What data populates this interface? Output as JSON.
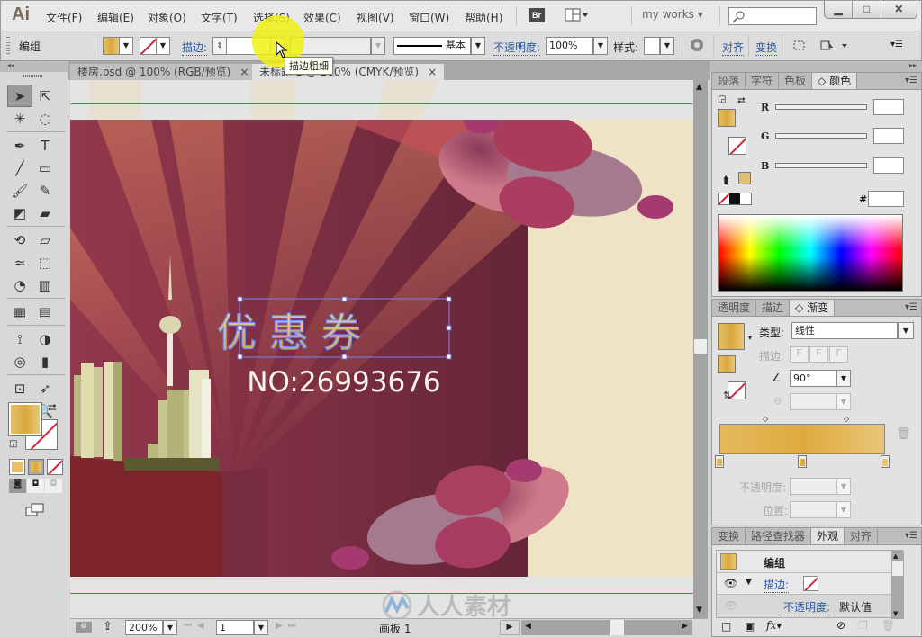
{
  "app": {
    "logo": "Ai"
  },
  "menubar": {
    "items": [
      "文件(F)",
      "编辑(E)",
      "对象(O)",
      "文字(T)",
      "选择(S)",
      "效果(C)",
      "视图(V)",
      "窗口(W)",
      "帮助(H)"
    ],
    "bridge_label": "Br",
    "workspace": "my works",
    "workspace_arrow": "▾",
    "search_placeholder": "",
    "window_buttons": {
      "minimize": "▁",
      "maximize": "□",
      "close": "✕"
    }
  },
  "controlbar": {
    "selection_label": "编组",
    "fill_color": "#e0b550",
    "stroke_label": "描边",
    "stroke_weight": "",
    "profile_label": "基本",
    "opacity_label": "不透明度",
    "opacity_value": "100%",
    "style_label": "样式",
    "align_label": "对齐",
    "transform_label": "变换"
  },
  "tooltip": {
    "text": "描边粗细"
  },
  "document_tabs": [
    {
      "label": "楼房.psd @ 100% (RGB/预览)",
      "close": "×"
    },
    {
      "label": "未标题-1 @ 200% (CMYK/预览)",
      "close": "×"
    }
  ],
  "artwork": {
    "title": "优惠券",
    "number": "NO:26993676",
    "background_color": "#8a2f45",
    "cream_color": "#efe3c6"
  },
  "tools": {
    "rows": [
      [
        "selection-tool",
        "direct-selection-tool"
      ],
      [
        "magic-wand-tool",
        "lasso-tool"
      ],
      [
        "pen-tool",
        "type-tool"
      ],
      [
        "line-tool",
        "rectangle-tool"
      ],
      [
        "paintbrush-tool",
        "pencil-tool"
      ],
      [
        "blob-brush-tool",
        "eraser-tool"
      ],
      [
        "rotate-tool",
        "free-transform-tool"
      ],
      [
        "width-tool",
        "shape-builder-tool"
      ],
      [
        "perspective-grid-tool",
        "graph-tool"
      ],
      [
        "mesh-tool",
        "gradient-tool"
      ],
      [
        "eyedropper-tool",
        "blend-tool"
      ],
      [
        "symbol-sprayer-tool",
        "column-graph-tool"
      ],
      [
        "artboard-tool",
        "slice-tool"
      ],
      [
        "hand-tool",
        "zoom-tool"
      ]
    ],
    "glyphs": [
      [
        "➤",
        "⇱"
      ],
      [
        "✳",
        "◌"
      ],
      [
        "✒",
        "T"
      ],
      [
        "╱",
        "▭"
      ],
      [
        "🖌",
        "✎"
      ],
      [
        "◩",
        "▰"
      ],
      [
        "⟲",
        "▱"
      ],
      [
        "≈",
        "⬚"
      ],
      [
        "◔",
        "▥"
      ],
      [
        "▦",
        "▤"
      ],
      [
        "⟟",
        "◑"
      ],
      [
        "◎",
        "▮"
      ],
      [
        "⊡",
        "➶"
      ],
      [
        "✋",
        "🔍"
      ]
    ]
  },
  "statusbar": {
    "zoom": "200%",
    "artboard_num": "1",
    "artboard_label": "画板 1"
  },
  "color_panel": {
    "tabs": [
      "段落",
      "字符",
      "色板",
      "颜色"
    ],
    "active_tab": "颜色",
    "labels": {
      "r": "R",
      "g": "G",
      "b": "B",
      "hex": "#"
    },
    "values": {
      "r": "",
      "g": "",
      "b": "",
      "hex": ""
    }
  },
  "gradient_panel": {
    "tabs": [
      "透明度",
      "描边",
      "渐变"
    ],
    "active_tab": "渐变",
    "type_label": "类型",
    "type_value": "线性",
    "stroke_label": "描边",
    "angle_value": "90°",
    "opacity_label": "不透明度",
    "location_label": "位置",
    "stops": [
      {
        "position": 0,
        "color": "#e3b95b"
      },
      {
        "position": 50,
        "color": "#dfaa3f"
      },
      {
        "position": 100,
        "color": "#e8c878"
      }
    ]
  },
  "appearance_panel": {
    "tabs": [
      "变换",
      "路径查找器",
      "外观",
      "对齐"
    ],
    "active_tab": "外观",
    "group_label": "编组",
    "stroke_label": "描边",
    "opacity_label": "不透明度",
    "opacity_value": "默认值"
  },
  "watermark": {
    "text": "人人素材"
  }
}
